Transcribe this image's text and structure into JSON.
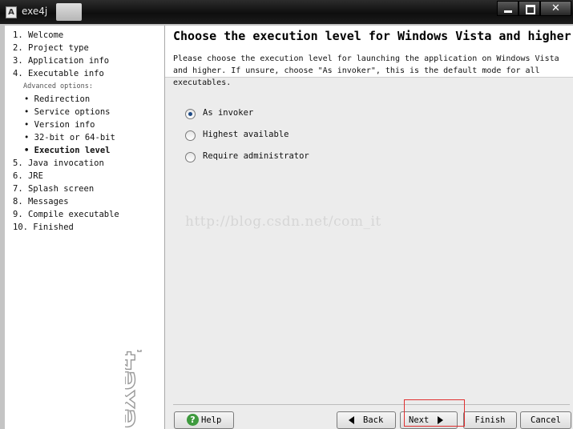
{
  "window": {
    "title": "exe4j",
    "title_icon": "A",
    "controls": {
      "minimize": "minimize-icon",
      "maximize": "maximize-icon",
      "close": "✕"
    }
  },
  "sidebar": {
    "steps": [
      {
        "label": "1. Welcome"
      },
      {
        "label": "2. Project type"
      },
      {
        "label": "3. Application info"
      },
      {
        "label": "4. Executable info"
      },
      {
        "label": "Advanced options:"
      },
      {
        "label": "• Redirection"
      },
      {
        "label": "• Service options"
      },
      {
        "label": "• Version info"
      },
      {
        "label": "• 32-bit or 64-bit"
      },
      {
        "label": "• Execution level",
        "active": true
      },
      {
        "label": "5. Java invocation"
      },
      {
        "label": "6. JRE"
      },
      {
        "label": "7. Splash screen"
      },
      {
        "label": "8. Messages"
      },
      {
        "label": "9. Compile executable"
      },
      {
        "label": "10. Finished"
      }
    ],
    "logo": "exe4j"
  },
  "main": {
    "title": "Choose the execution level for Windows Vista and higher",
    "description": "Please choose the execution level for launching the application on Windows Vista and higher. If unsure, choose \"As invoker\", this is the default mode for all executables.",
    "options": [
      {
        "label": "As invoker",
        "checked": true
      },
      {
        "label": "Highest available",
        "checked": false
      },
      {
        "label": "Require administrator",
        "checked": false
      }
    ],
    "watermark": "http://blog.csdn.net/com_it"
  },
  "buttons": {
    "help": "Help",
    "back": "Back",
    "next": "Next",
    "finish": "Finish",
    "cancel": "Cancel"
  },
  "colors": {
    "accent_radio": "#1e4a86",
    "help_icon": "#3e9a3e",
    "highlight_box": "#e03030"
  }
}
